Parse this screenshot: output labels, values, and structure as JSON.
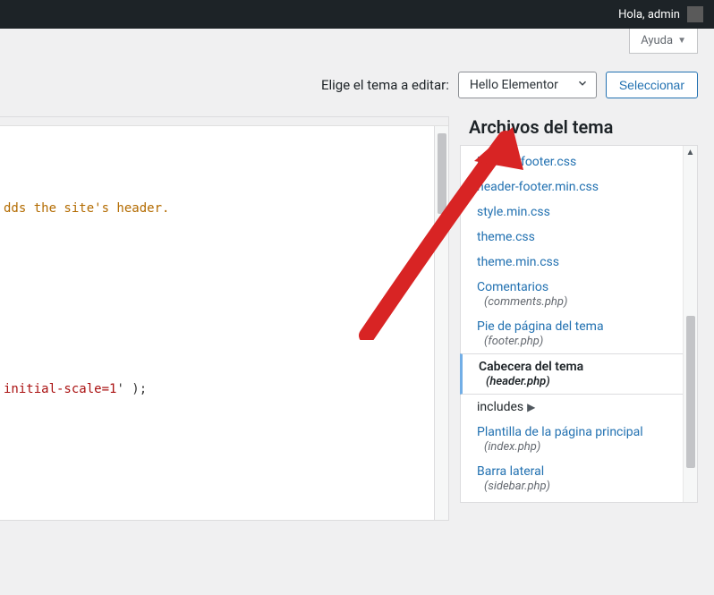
{
  "admin_bar": {
    "greeting": "Hola, admin"
  },
  "screen_meta": {
    "help_label": "Ayuda"
  },
  "theme_selector": {
    "label": "Elige el tema a editar:",
    "selected": "Hello Elementor",
    "button": "Seleccionar"
  },
  "editor": {
    "comment_fragment": "dds the site's header.",
    "code_fragment_prefix": "initial-scale=1",
    "code_fragment_suffix": "' );"
  },
  "sidebar": {
    "heading": "Archivos del tema",
    "files": [
      {
        "title": "Header-footer.css"
      },
      {
        "title": "header-footer.min.css"
      },
      {
        "title": "style.min.css"
      },
      {
        "title": "theme.css"
      },
      {
        "title": "theme.min.css"
      },
      {
        "title": "Comentarios",
        "sub": "(comments.php)"
      },
      {
        "title": "Pie de página del tema",
        "sub": "(footer.php)"
      },
      {
        "title": "Cabecera del tema",
        "sub": "(header.php)",
        "active": true
      },
      {
        "title": "includes",
        "section": true
      },
      {
        "title": "Plantilla de la página principal",
        "sub": "(index.php)"
      },
      {
        "title": "Barra lateral",
        "sub": "(sidebar.php)"
      }
    ]
  }
}
